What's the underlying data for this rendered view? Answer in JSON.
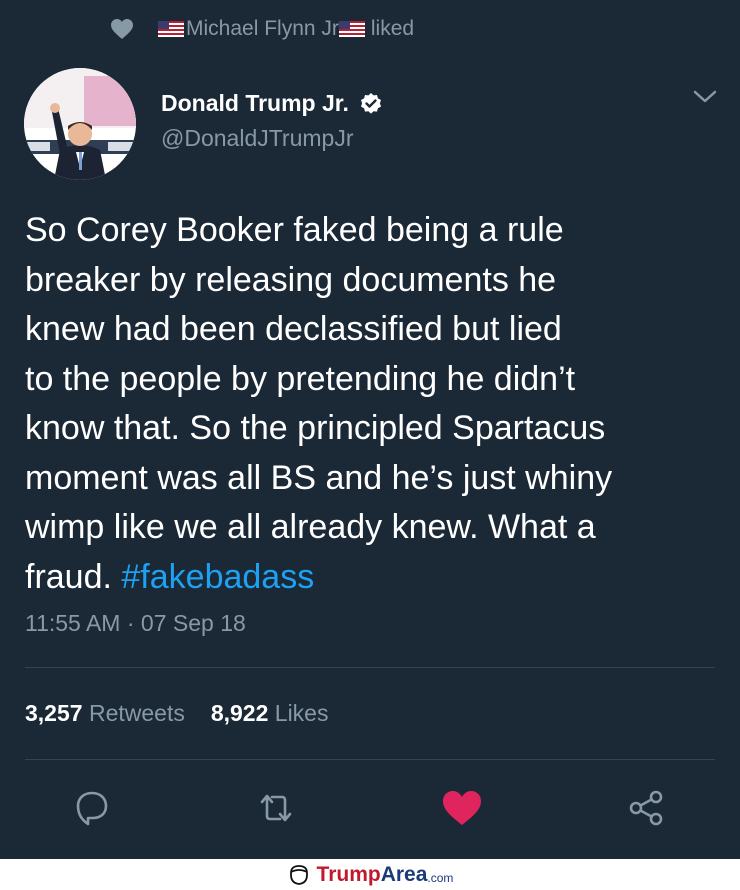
{
  "social_context": {
    "name": "Michael Flynn Jr",
    "action": "liked"
  },
  "author": {
    "name": "Donald Trump Jr.",
    "handle": "@DonaldJTrumpJr"
  },
  "tweet": {
    "text": "So Corey Booker faked being a rule\nbreaker by releasing documents he\nknew had been declassified but lied\nto the people by pretending he didn’t\nknow that. So the principled Spartacus\nmoment was all BS and he’s just whiny\nwimp like we all already knew. What a\nfraud. ",
    "hashtag": "#fakebadass",
    "timestamp": "11:55 AM · 07 Sep 18"
  },
  "stats": {
    "retweets_count": "3,257",
    "retweets_label": "Retweets",
    "likes_count": "8,922",
    "likes_label": "Likes"
  },
  "colors": {
    "background": "#1b2836",
    "secondary_text": "#8899a6",
    "link": "#1da1f2",
    "like_active": "#e0245e"
  },
  "icons": {
    "context": "heart-icon",
    "verified": "verified-badge-icon",
    "menu": "chevron-down-icon",
    "reply": "reply-icon",
    "retweet": "retweet-icon",
    "like": "heart-filled-icon",
    "share": "share-icon"
  },
  "watermark": {
    "part1": "Trump",
    "part2": "Area",
    "part3": ".com"
  }
}
